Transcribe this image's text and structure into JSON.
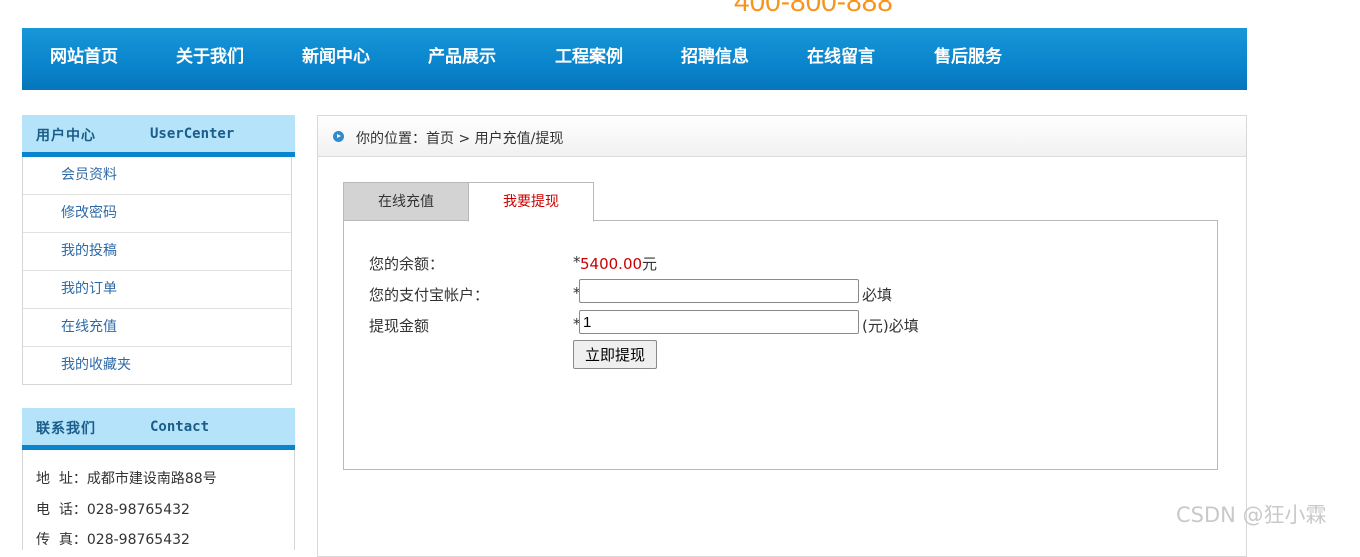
{
  "header": {
    "phone": "400-800-888"
  },
  "nav": {
    "items": [
      {
        "label": "网站首页"
      },
      {
        "label": "关于我们"
      },
      {
        "label": "新闻中心"
      },
      {
        "label": "产品展示"
      },
      {
        "label": "工程案例"
      },
      {
        "label": "招聘信息"
      },
      {
        "label": "在线留言"
      },
      {
        "label": "售后服务"
      }
    ]
  },
  "user_center": {
    "title_cn": "用户中心",
    "title_en": "UserCenter",
    "items": [
      {
        "label": "会员资料"
      },
      {
        "label": "修改密码"
      },
      {
        "label": "我的投稿"
      },
      {
        "label": "我的订单"
      },
      {
        "label": "在线充值"
      },
      {
        "label": "我的收藏夹"
      }
    ]
  },
  "contact": {
    "title_cn": "联系我们",
    "title_en": "Contact",
    "lines": [
      "地  址：成都市建设南路88号",
      "电  话：028-98765432",
      "传  真：028-98765432"
    ]
  },
  "breadcrumb": {
    "prefix": "你的位置：",
    "home": "首页",
    "separator": " > ",
    "current": "用户充值/提现"
  },
  "tabs": [
    {
      "label": "在线充值",
      "active": false
    },
    {
      "label": "我要提现",
      "active": true
    }
  ],
  "form": {
    "balance_label": "您的余额：",
    "star": "*",
    "balance_value": "5400.00",
    "balance_unit": "元",
    "alipay_label": "您的支付宝帐户：",
    "alipay_value": "",
    "alipay_hint": "必填",
    "amount_label": "提现金额",
    "amount_value": "1",
    "amount_hint": "(元)必填",
    "submit_label": "立即提现"
  },
  "watermark": "CSDN @狂小霖",
  "colors": {
    "nav_bg": "#0a84cc",
    "phone": "#f7941d",
    "side_head_bg": "#b5e3fa",
    "highlight_red": "#cc0000",
    "link_blue": "#2f6aa6"
  }
}
